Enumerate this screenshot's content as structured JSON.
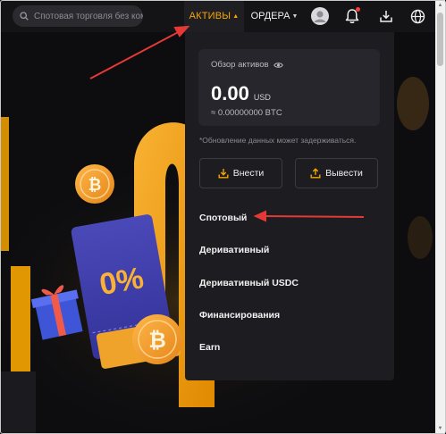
{
  "topbar": {
    "search_placeholder": "Спотовая торговля без ком",
    "nav_assets": "АКТИВЫ",
    "nav_orders": "ОРДЕРА",
    "icons": [
      "search-icon",
      "avatar-icon",
      "bell-icon",
      "download-icon",
      "globe-icon"
    ]
  },
  "hero": {
    "ticket_text": "0%"
  },
  "panel": {
    "overview_label": "Обзор активов",
    "balance": "0.00",
    "balance_currency": "USD",
    "balance_btc": "≈ 0.00000000 BTC",
    "delay_note": "*Обновление данных может задерживаться.",
    "deposit_label": "Внести",
    "withdraw_label": "Вывести",
    "menu": [
      {
        "label": "Спотовый"
      },
      {
        "label": "Деривативный"
      },
      {
        "label": "Деривативный USDC"
      },
      {
        "label": "Финансирования"
      },
      {
        "label": "Earn"
      }
    ]
  },
  "colors": {
    "accent": "#f7a600",
    "background": "#0d0d10",
    "panel": "#1c1c21",
    "annotation": "#e53935"
  }
}
